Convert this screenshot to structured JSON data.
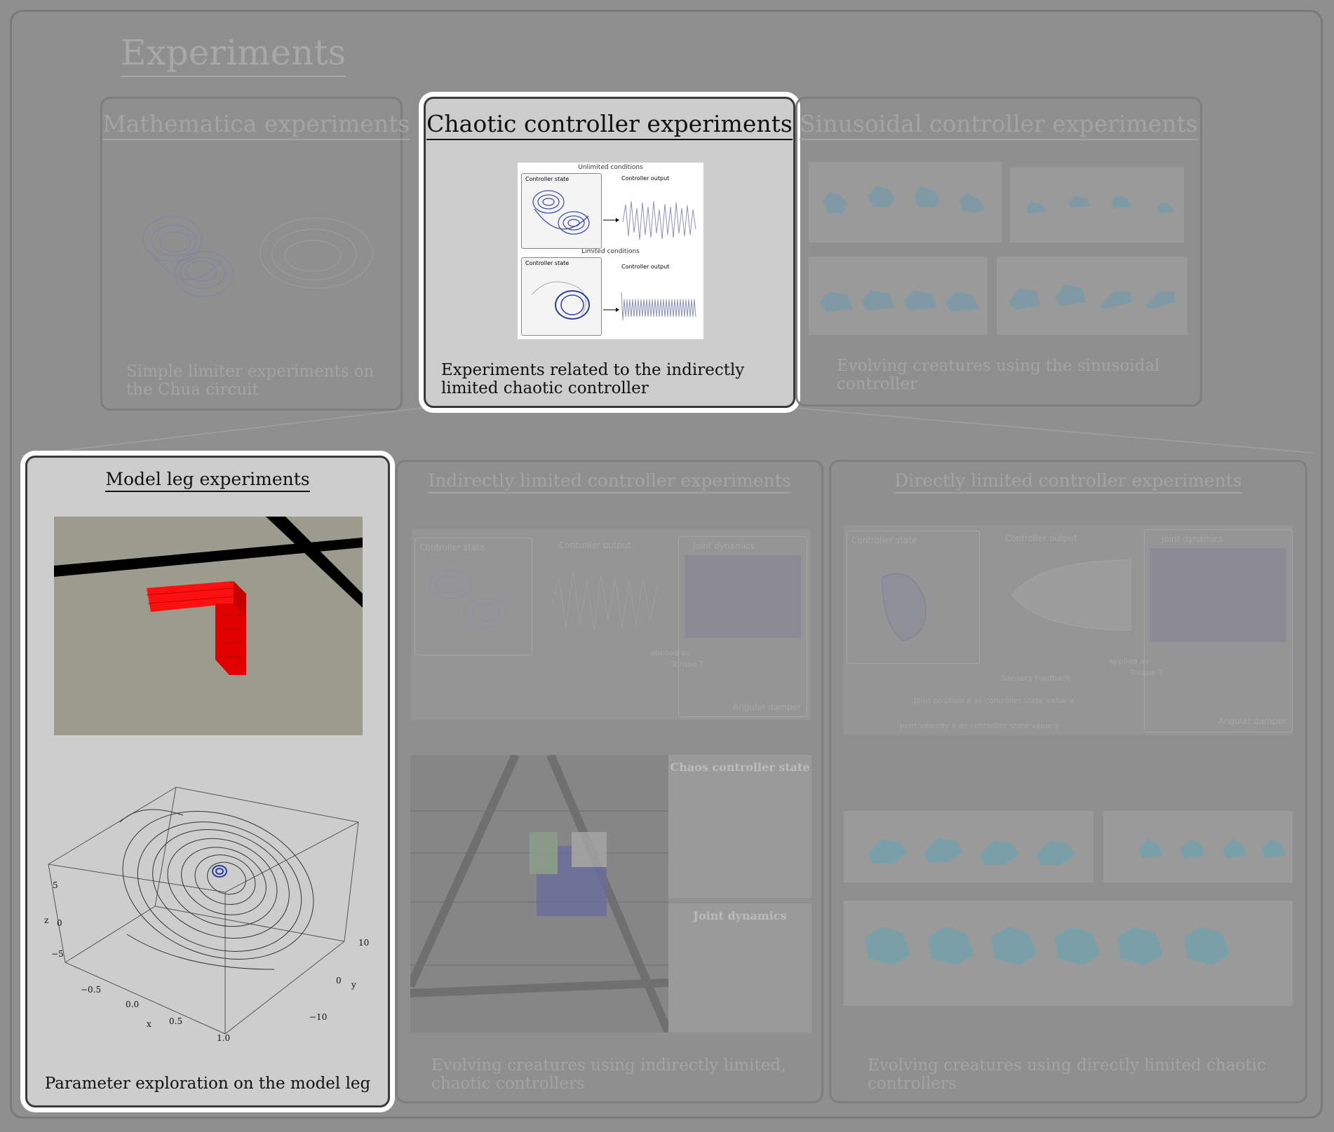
{
  "page_title": "Experiments",
  "top_row": [
    {
      "title": "Mathematica experiments",
      "caption": "Simple limiter experiments on the Chua circuit"
    },
    {
      "title": "Chaotic controller experiments",
      "caption": "Experiments related to the indirectly limited chaotic controller",
      "figure": {
        "label_unlimited": "Unlimited conditions",
        "label_limited": "Limited conditions",
        "state_label": "Controller state",
        "output_label": "Controller output"
      }
    },
    {
      "title": "Sinusoidal controller experiments",
      "caption": "Evolving creatures using the sinusoidal controller"
    }
  ],
  "bottom_row": [
    {
      "title": "Model leg experiments",
      "caption": "Parameter exploration on the model leg",
      "plot": {
        "z_label": "z",
        "z_ticks": [
          "5",
          "0",
          "−5"
        ],
        "x_label": "x",
        "x_ticks": [
          "−0.5",
          "0.0",
          "0.5",
          "1.0"
        ],
        "y_label": "y",
        "y_ticks": [
          "10",
          "0",
          "−10"
        ]
      }
    },
    {
      "title": "Indirectly limited controller experiments",
      "caption": "Evolving creatures using indirectly limited, chaotic controllers",
      "diagram": {
        "state": "Controller state",
        "output": "Controller output",
        "joint": "Joint dynamics",
        "applied": "applied as",
        "torque": "Torque T",
        "damper": "Angular damper",
        "chaos_state": "Chaos controller state",
        "joint_dyn": "Joint dynamics"
      }
    },
    {
      "title": "Directly limited controller experiments",
      "caption": "Evolving creatures using directly limited chaotic controllers",
      "diagram": {
        "state": "Controller state",
        "output": "Controller output",
        "joint": "Joint dynamics",
        "applied": "applied as",
        "torque": "Torque T",
        "damper": "Angular damper",
        "sensory": "Sensory feedback",
        "pos": "Joint position x as controller state value x",
        "vel": "Joint velocity ẋ as controller state value y"
      }
    }
  ],
  "colors": {
    "background": "#8f8f8f",
    "active_card": "#cdcdcd",
    "dim_text": "#a4a4a4",
    "red_block": "#ff0000",
    "creature": "#7f9aa4"
  }
}
